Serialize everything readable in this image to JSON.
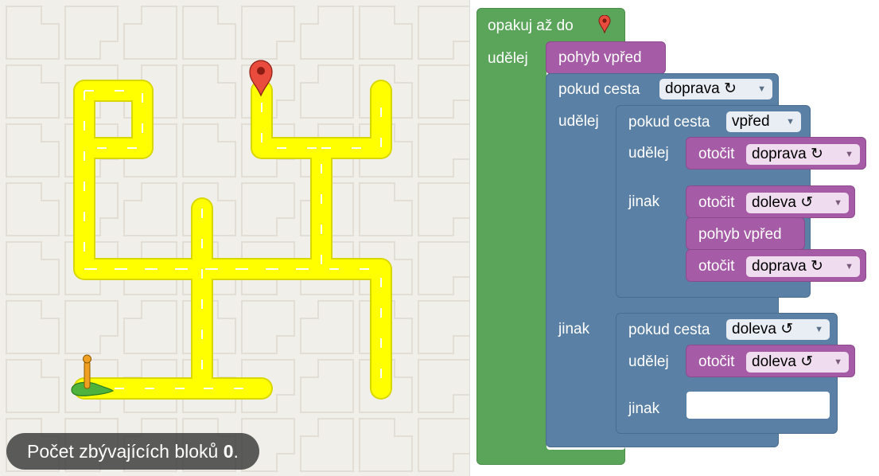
{
  "status": {
    "remaining_prefix": "Počet zbývajících bloků",
    "remaining_count": "0",
    "remaining_suffix": "."
  },
  "colors": {
    "loop_green": "#5ba55b",
    "logic_blue": "#5b80a5",
    "action_purple": "#a55ba5",
    "road_yellow": "#ffff00"
  },
  "icons": {
    "goal": "red-map-marker",
    "player": "pegman-on-green-base"
  },
  "program": {
    "repeat_label": "opakuj až do",
    "repeat_do": "udělej",
    "move_forward": "pohyb vpřed",
    "if1_label": "pokud cesta",
    "if1_dir": "doprava ↻",
    "if1_do": "udělej",
    "if1_else": "jinak",
    "if2_label": "pokud cesta",
    "if2_dir": "vpřed",
    "if2_do": "udělej",
    "if2_else": "jinak",
    "turn_label": "otočit",
    "turn_right": "doprava ↻",
    "turn_left": "doleva ↺",
    "move_forward2": "pohyb vpřed",
    "if3_label": "pokud cesta",
    "if3_dir": "doleva ↺",
    "if3_do": "udělej",
    "if3_else": "jinak"
  }
}
